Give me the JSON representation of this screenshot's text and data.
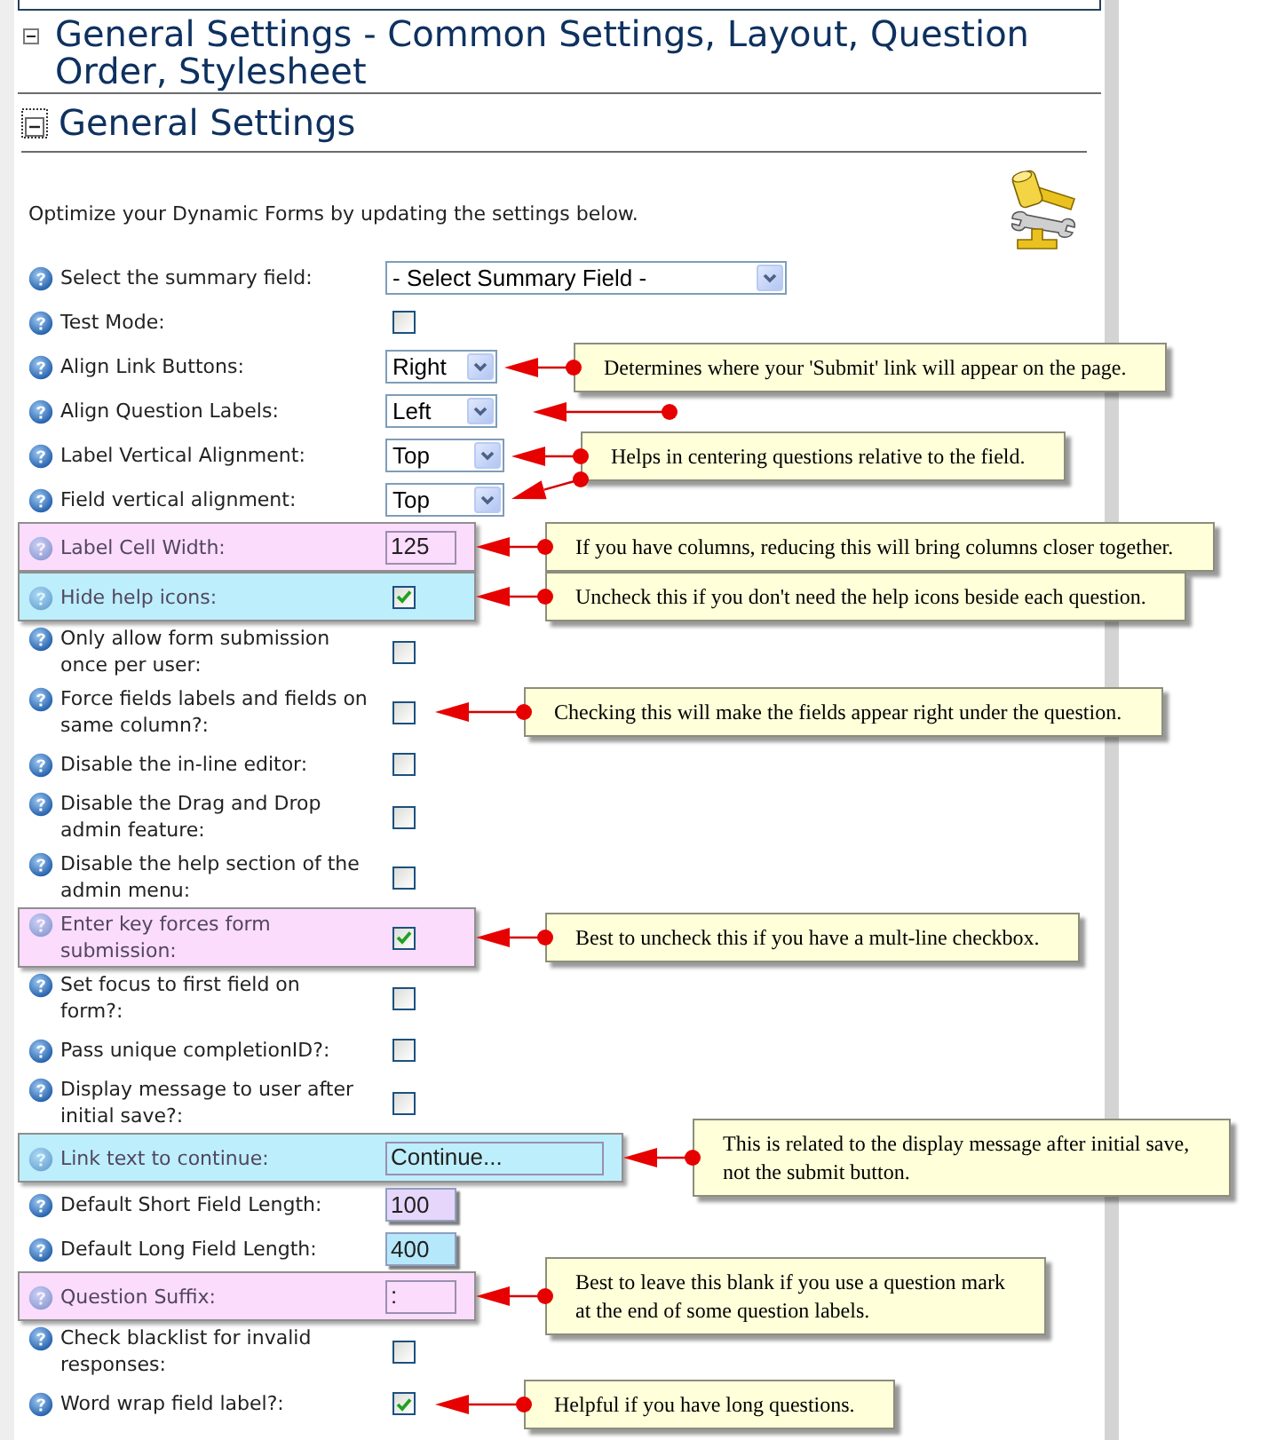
{
  "page_title": {
    "text": "General Settings - Common Settings, Layout, Question Order, Stylesheet",
    "expanded": true
  },
  "section": {
    "title": "General Settings",
    "expanded": true,
    "description": "Optimize your Dynamic Forms by updating the settings below."
  },
  "settings": [
    {
      "kind": "select",
      "label": "Select the summary field:",
      "value": "- Select Summary Field -"
    },
    {
      "kind": "checkbox",
      "label": "Test Mode:",
      "checked": false
    },
    {
      "kind": "select",
      "label": "Align Link Buttons:",
      "value": "Right",
      "annotation": {
        "kind": "callout",
        "text": "Determines where your 'Submit' link will appear on the page."
      }
    },
    {
      "kind": "select",
      "label": "Align Question Labels:",
      "value": "Left",
      "annotation": {
        "kind": "arrow"
      }
    },
    {
      "kind": "select",
      "label": "Label Vertical Alignment:",
      "value": "Top",
      "annotation": {
        "kind": "callout",
        "text": "Helps in centering questions relative to the field."
      }
    },
    {
      "kind": "select",
      "label": "Field vertical alignment:",
      "value": "Top",
      "annotation": {
        "kind": "branch-arrow"
      }
    },
    {
      "kind": "text",
      "label": "Label Cell Width:",
      "value": "125",
      "highlight": {
        "kind": "row",
        "color": "#fcdcfc"
      },
      "annotation": {
        "kind": "callout",
        "text": "If you have columns, reducing this will bring columns closer together."
      }
    },
    {
      "kind": "checkbox",
      "label": "Hide help icons:",
      "checked": true,
      "highlight": {
        "kind": "row",
        "color": "#bdeefb"
      },
      "annotation": {
        "kind": "callout",
        "text": "Uncheck this if you don't need the help icons beside each question."
      }
    },
    {
      "kind": "checkbox",
      "label": "Only allow form submission\nonce per user:",
      "checked": false
    },
    {
      "kind": "checkbox",
      "label": "Force fields labels and fields on\nsame column?:",
      "checked": false,
      "annotation": {
        "kind": "callout",
        "text": "Checking this will make the fields appear right under the question."
      }
    },
    {
      "kind": "checkbox",
      "label": "Disable the in-line editor:",
      "checked": false
    },
    {
      "kind": "checkbox",
      "label": "Disable the Drag and Drop\nadmin feature:",
      "checked": false
    },
    {
      "kind": "checkbox",
      "label": "Disable the help section of the\nadmin menu:",
      "checked": false
    },
    {
      "kind": "checkbox",
      "label": "Enter key forces form\nsubmission:",
      "checked": true,
      "highlight": {
        "kind": "row",
        "color": "#fcdcfc"
      },
      "annotation": {
        "kind": "callout",
        "text": "Best to uncheck this if you have a mult-line checkbox."
      }
    },
    {
      "kind": "checkbox",
      "label": "Set focus to first field on\nform?:",
      "checked": false
    },
    {
      "kind": "checkbox",
      "label": "Pass unique completionID?:",
      "checked": false
    },
    {
      "kind": "checkbox",
      "label": "Display message to user after\ninitial save?:",
      "checked": false
    },
    {
      "kind": "text",
      "label": "Link text to continue:",
      "value": "Continue...",
      "highlight": {
        "kind": "row",
        "color": "#bdeefb"
      },
      "annotation": {
        "kind": "callout",
        "text": "This is related to the display message after initial save,\nnot the submit button."
      }
    },
    {
      "kind": "text",
      "label": "Default Short Field Length:",
      "value": "100",
      "highlight": {
        "kind": "field",
        "color": "#e6d6fb"
      }
    },
    {
      "kind": "text",
      "label": "Default Long Field Length:",
      "value": "400",
      "highlight": {
        "kind": "field",
        "color": "#b6e8fb"
      }
    },
    {
      "kind": "text",
      "label": "Question Suffix:",
      "value": ":",
      "highlight": {
        "kind": "row",
        "color": "#fcdcfc"
      },
      "annotation": {
        "kind": "callout",
        "text": "Best to leave this blank if you use a question mark\nat the end of some question labels."
      }
    },
    {
      "kind": "checkbox",
      "label": "Check blacklist for invalid\nresponses:",
      "checked": false
    },
    {
      "kind": "checkbox",
      "label": "Word wrap field label?:",
      "checked": true,
      "annotation": {
        "kind": "callout",
        "text": "Helpful if you have long questions."
      }
    }
  ]
}
